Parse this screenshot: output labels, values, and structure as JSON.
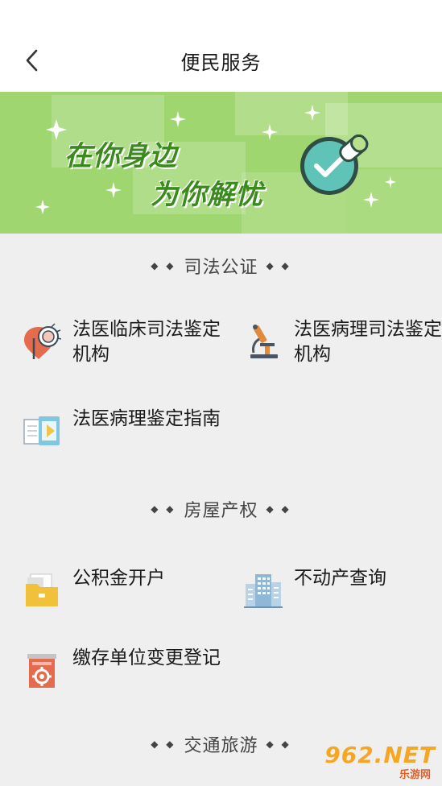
{
  "header": {
    "title": "便民服务"
  },
  "banner": {
    "line1": "在你身边",
    "line2": "为你解忧"
  },
  "sections": [
    {
      "title": "司法公证",
      "items": [
        {
          "label": "法医临床司法鉴定机构",
          "icon": "map-pin-heart-icon"
        },
        {
          "label": "法医病理司法鉴定机构",
          "icon": "microscope-icon"
        },
        {
          "label": "法医病理鉴定指南",
          "icon": "documents-icon"
        }
      ]
    },
    {
      "title": "房屋产权",
      "items": [
        {
          "label": "公积金开户",
          "icon": "folder-icon"
        },
        {
          "label": "不动产查询",
          "icon": "building-icon"
        },
        {
          "label": "缴存单位变更登记",
          "icon": "register-gear-icon"
        }
      ]
    },
    {
      "title": "交通旅游"
    }
  ],
  "section_dots": {
    "left": "◆ ◆",
    "right": "◆ ◆"
  },
  "watermark": {
    "logo": "962.NET",
    "sub": "乐游网"
  },
  "colors": {
    "banner_bg": "#9fd66f",
    "banner_text": "#3b8a1e",
    "check_circle": "#5fc3b7"
  }
}
